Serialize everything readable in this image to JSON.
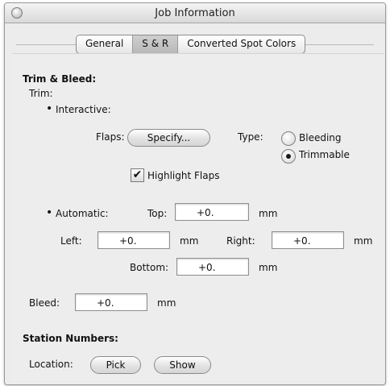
{
  "window": {
    "title": "Job Information"
  },
  "tabs": [
    {
      "label": "General",
      "active": false
    },
    {
      "label": "S & R",
      "active": true
    },
    {
      "label": "Converted Spot Colors",
      "active": false
    }
  ],
  "trim_bleed": {
    "heading": "Trim & Bleed:",
    "trim_label": "Trim:",
    "bullet": "•",
    "interactive_label": "Interactive:",
    "flaps_label": "Flaps:",
    "specify_button": "Specify...",
    "type_label": "Type:",
    "type_options": [
      {
        "label": "Bleeding",
        "selected": false
      },
      {
        "label": "Trimmable",
        "selected": true
      }
    ],
    "highlight_flaps": {
      "label": "Highlight Flaps",
      "checked": true,
      "check_glyph": "✔"
    },
    "automatic_label": "Automatic:",
    "top": {
      "label": "Top:",
      "value": "+0.",
      "unit": "mm"
    },
    "left": {
      "label": "Left:",
      "value": "+0.",
      "unit": "mm"
    },
    "right": {
      "label": "Right:",
      "value": "+0.",
      "unit": "mm"
    },
    "bottom": {
      "label": "Bottom:",
      "value": "+0.",
      "unit": "mm"
    },
    "bleed": {
      "label": "Bleed:",
      "value": "+0.",
      "unit": "mm"
    }
  },
  "station_numbers": {
    "heading": "Station Numbers:",
    "location_label": "Location:",
    "pick_button": "Pick",
    "show_button": "Show"
  }
}
